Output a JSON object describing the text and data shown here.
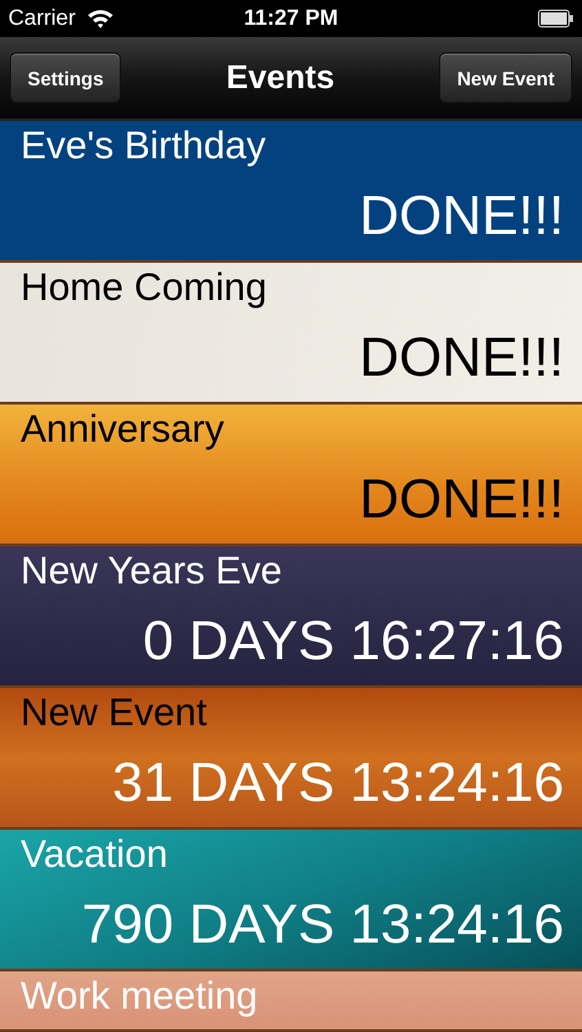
{
  "status_bar": {
    "carrier": "Carrier",
    "time": "11:27 PM"
  },
  "nav_bar": {
    "title": "Events",
    "left_button": "Settings",
    "right_button": "New Event"
  },
  "events": [
    {
      "title": "Eve's Birthday",
      "countdown": "DONE!!!",
      "kind": "blue"
    },
    {
      "title": "Home Coming",
      "countdown": "DONE!!!",
      "kind": "paper"
    },
    {
      "title": "Anniversary",
      "countdown": "DONE!!!",
      "kind": "orange"
    },
    {
      "title": "New Years Eve",
      "countdown": "0 DAYS 16:27:16",
      "kind": "navy"
    },
    {
      "title": "New Event",
      "countdown": "31 DAYS 13:24:16",
      "kind": "wood"
    },
    {
      "title": "Vacation",
      "countdown": "790 DAYS 13:24:16",
      "kind": "teal"
    },
    {
      "title": "Work meeting",
      "kind": "peach"
    }
  ]
}
